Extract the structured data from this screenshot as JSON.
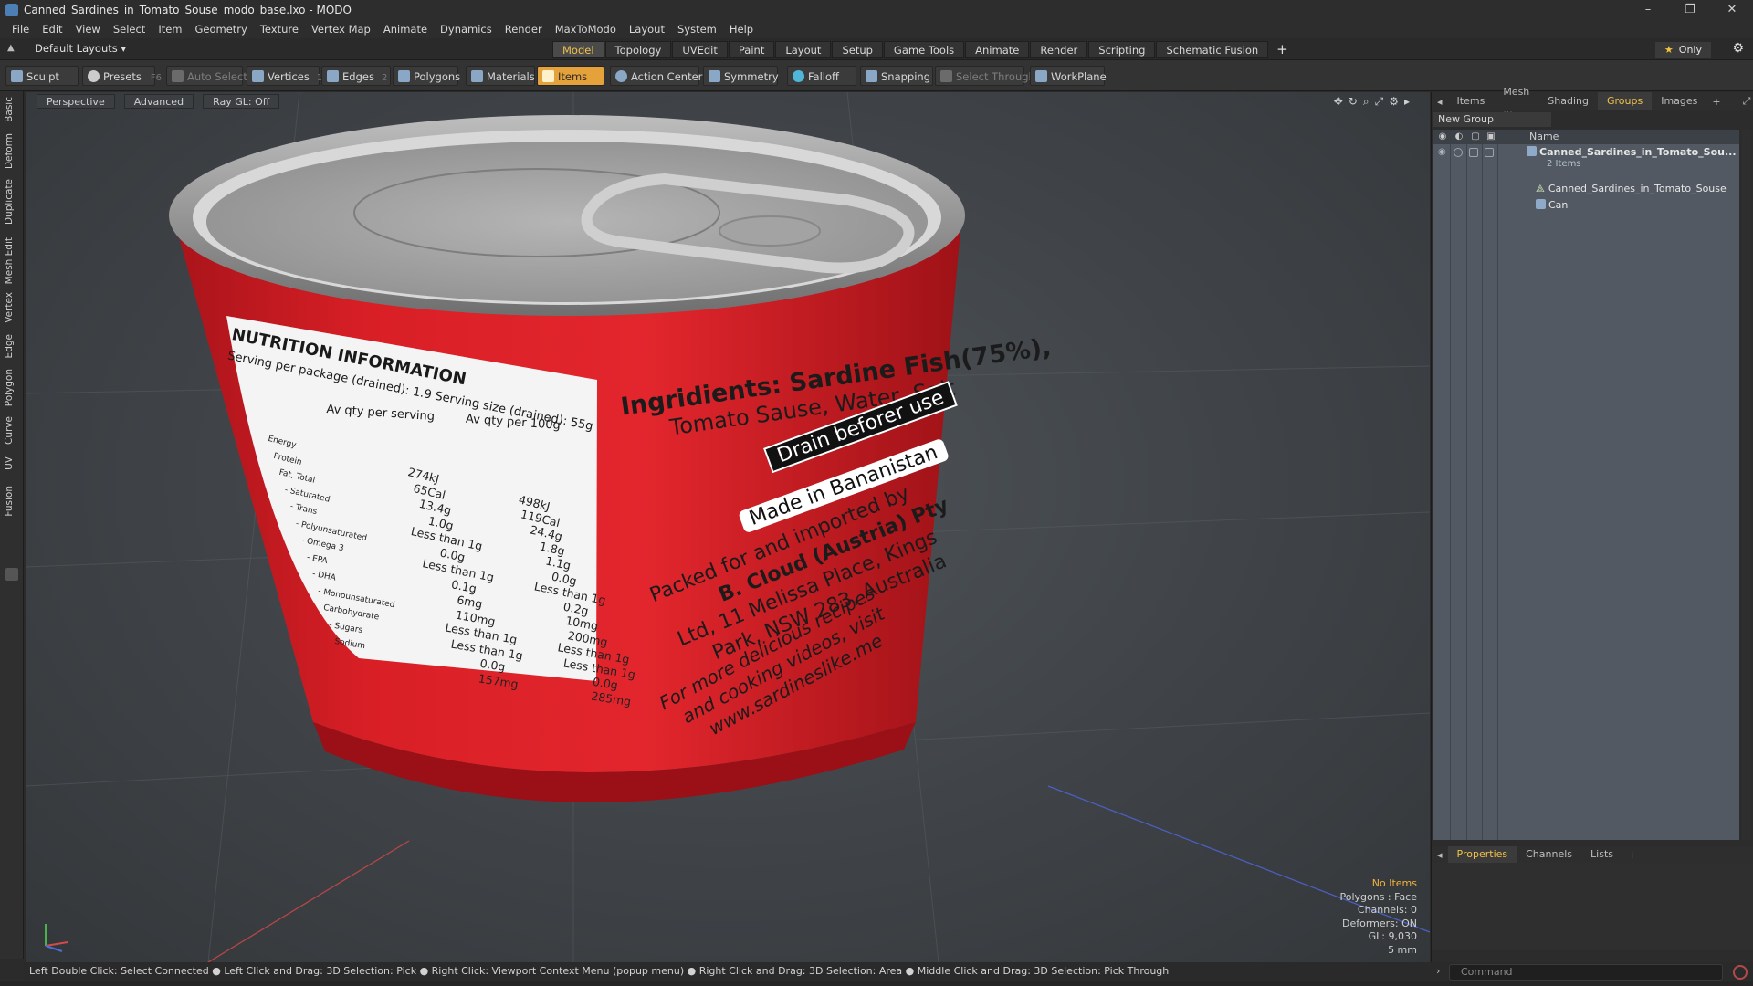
{
  "window": {
    "title": "Canned_Sardines_in_Tomato_Souse_modo_base.lxo - MODO",
    "controls": [
      "–",
      "❐",
      "✕"
    ]
  },
  "menu": [
    "File",
    "Edit",
    "View",
    "Select",
    "Item",
    "Geometry",
    "Texture",
    "Vertex Map",
    "Animate",
    "Dynamics",
    "Render",
    "MaxToModo",
    "Layout",
    "System",
    "Help"
  ],
  "layoutbar": {
    "default_layouts": "Default Layouts ▾",
    "tabs": [
      "Model",
      "Topology",
      "UVEdit",
      "Paint",
      "Layout",
      "Setup",
      "Game Tools",
      "Animate",
      "Render",
      "Scripting",
      "Schematic Fusion"
    ],
    "active_tab": "Model",
    "plus": "+",
    "only": "Only"
  },
  "toolbar": {
    "sculpt": "Sculpt",
    "presets": "Presets",
    "presets_key": "F6",
    "auto_select": "Auto Select",
    "vertices": "Vertices",
    "vertices_count": "1",
    "edges": "Edges",
    "edges_count": "2",
    "polygons": "Polygons",
    "materials": "Materials",
    "items": "Items",
    "action_center": "Action Center",
    "symmetry": "Symmetry",
    "falloff": "Falloff",
    "snapping": "Snapping",
    "select_through": "Select Through",
    "workplane": "WorkPlane"
  },
  "left_tabs": [
    "Basic",
    "Deform",
    "Duplicate",
    "Mesh Edit",
    "Vertex",
    "Edge",
    "Polygon",
    "Curve",
    "UV",
    "Fusion"
  ],
  "viewport": {
    "buttons": [
      "Perspective",
      "Advanced",
      "Ray GL: Off"
    ],
    "stats": {
      "no_items": "No Items",
      "polygons": "Polygons : Face",
      "channels": "Channels: 0",
      "deformers": "Deformers: ON",
      "gl": "GL: 9,030",
      "scale": "5 mm"
    }
  },
  "can_label": {
    "nutrition_title": "NUTRITION INFORMATION",
    "serving_line": "Serving per package (drained): 1.9 Serving size (drained): 55g",
    "col1": "Av qty per serving",
    "col2": "Av qty per 100g",
    "rows": [
      [
        "Energy",
        "274kJ",
        "498kJ"
      ],
      [
        "Protein",
        "65Cal",
        "119Cal"
      ],
      [
        "Fat, Total",
        "13.4g",
        "24.4g"
      ],
      [
        "- Saturated",
        "1.0g",
        "1.8g"
      ],
      [
        "- Trans",
        "Less than 1g",
        "1.1g"
      ],
      [
        "- Polyunsaturated",
        "0.0g",
        "0.0g"
      ],
      [
        "- Omega 3",
        "Less than 1g",
        "Less than 1g"
      ],
      [
        "- EPA",
        "0.1g",
        "0.2g"
      ],
      [
        "- DHA",
        "6mg",
        "10mg"
      ],
      [
        "- Monounsaturated",
        "110mg",
        "200mg"
      ],
      [
        "Carbohydrate",
        "Less than 1g",
        "Less than 1g"
      ],
      [
        "- Sugars",
        "Less than 1g",
        "Less than 1g"
      ],
      [
        "Sodium",
        "0.0g",
        "0.0g"
      ],
      [
        "",
        "157mg",
        "285mg"
      ]
    ],
    "ingredients_1": "Ingridients: Sardine Fish(75%),",
    "ingredients_2": "Tomato Sause, Water, Salt",
    "drain": "Drain beforer use",
    "made_in": "Made in Bananistan",
    "packed_1": "Packed for and imported by",
    "packed_2": "B. Cloud (Austria) Pty",
    "packed_3": "Ltd, 11 Melissa Place, Kings",
    "packed_4": "Park, NSW 283, Australia",
    "more_1": "For more delicious recipes",
    "more_2": "and cooking videos, visit",
    "website": "www.sardineslike.me"
  },
  "right_panel": {
    "tabs": [
      "Items",
      "Mesh ...",
      "Shading",
      "Groups",
      "Images"
    ],
    "active_tab": "Groups",
    "new_group": "New Group",
    "name_header": "Name",
    "group_name": "Canned_Sardines_in_Tomato_Sou...",
    "group_count": "2 Items",
    "children": [
      "Canned_Sardines_in_Tomato_Souse",
      "Can"
    ],
    "bottom_tabs": [
      "Properties",
      "Channels",
      "Lists"
    ],
    "active_bottom_tab": "Properties",
    "command_placeholder": "Command"
  },
  "statusbar": "Left Double Click: Select Connected ● Left Click and Drag: 3D Selection: Pick ● Right Click: Viewport Context Menu (popup menu) ● Right Click and Drag: 3D Selection: Area ● Middle Click and Drag: 3D Selection: Pick Through",
  "colors": {
    "accent": "#f0c24b",
    "items_active": "#e6a23a",
    "can_red": "#d81f26",
    "lid_gray": "#9c9c9c",
    "viewport_bg": "#44484c"
  }
}
